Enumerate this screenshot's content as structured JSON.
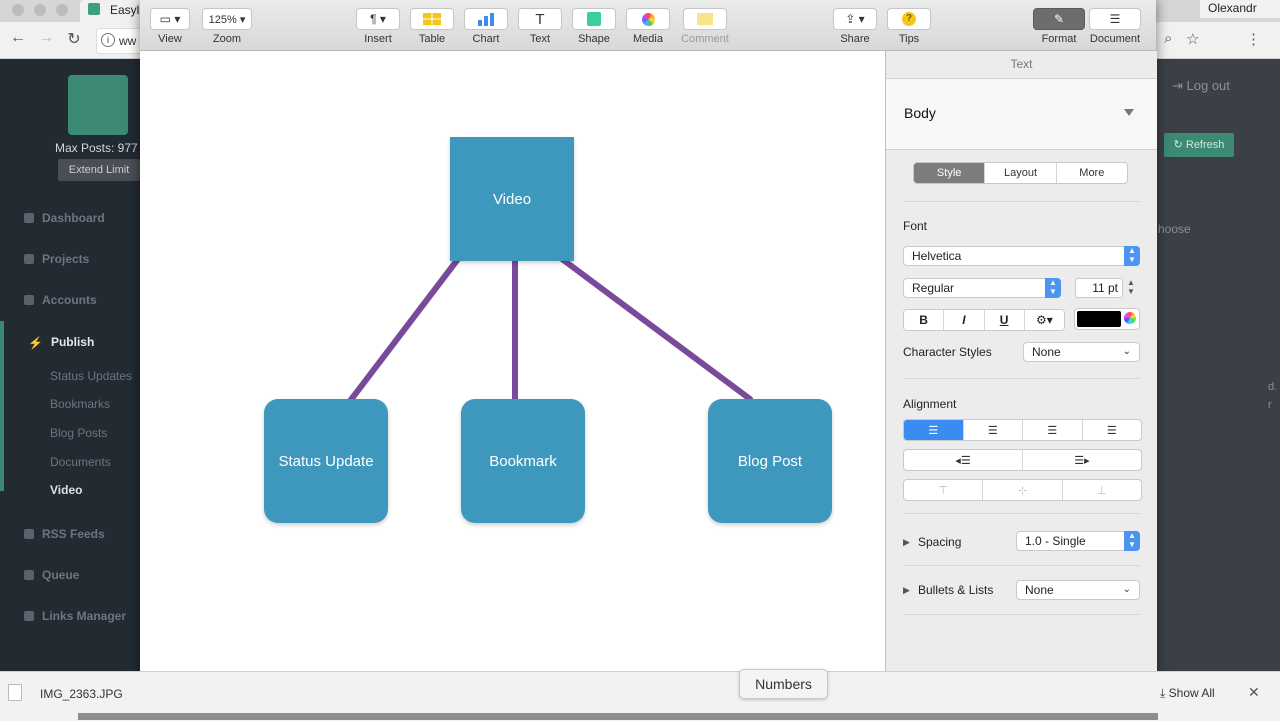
{
  "browser": {
    "tab_title": "Easyl",
    "profile_name": "Olexandr",
    "url_partial": "ww",
    "back": "←",
    "forward": "→",
    "reload": "↻",
    "zoom_glyph": "⌕",
    "star_glyph": "☆",
    "menu_glyph": "⋮"
  },
  "app_sidebar": {
    "max_posts": "Max Posts: 977",
    "extend_limit": "Extend Limit",
    "menu": {
      "dashboard": "Dashboard",
      "projects": "Projects",
      "accounts": "Accounts",
      "publish": "Publish",
      "publish_icon": "⚡",
      "rss_feeds": "RSS Feeds",
      "queue": "Queue",
      "links_manager": "Links Manager"
    },
    "publish_sub": {
      "status_updates": "Status Updates",
      "bookmarks": "Bookmarks",
      "blog_posts": "Blog Posts",
      "documents": "Documents",
      "video": "Video"
    }
  },
  "app_right": {
    "logout": "Log out",
    "refresh": "Refresh",
    "hint": "hoose",
    "frag1": "d.",
    "frag2": "r"
  },
  "toolbar": {
    "view": "View",
    "view_glyph": "▭ ▾",
    "zoom": "Zoom",
    "zoom_value": "125% ▾",
    "insert": "Insert",
    "insert_glyph": "¶ ▾",
    "table": "Table",
    "chart": "Chart",
    "text": "Text",
    "text_glyph": "T",
    "shape": "Shape",
    "media": "Media",
    "comment": "Comment",
    "share": "Share",
    "share_glyph": "⇪ ▾",
    "tips": "Tips",
    "tips_glyph": "?",
    "format": "Format",
    "format_glyph": "✎",
    "document": "Document",
    "document_glyph": "☰"
  },
  "diagram": {
    "top": "Video",
    "left": "Status Update",
    "middle": "Bookmark",
    "right": "Blog Post",
    "node_color": "#3e98bd",
    "connector_color": "#7a4a9a"
  },
  "inspector": {
    "title": "Text",
    "paragraph_style": "Body",
    "tabs": [
      "Style",
      "Layout",
      "More"
    ],
    "font_label": "Font",
    "font_family": "Helvetica",
    "font_typeface": "Regular",
    "font_size": "11 pt",
    "bold": "B",
    "italic": "I",
    "underline": "U",
    "gear": "⚙▾",
    "char_styles_label": "Character Styles",
    "char_styles_value": "None",
    "alignment_label": "Alignment",
    "spacing_label": "Spacing",
    "spacing_value": "1.0 - Single",
    "bullets_label": "Bullets & Lists",
    "bullets_value": "None",
    "text_color": "#000000"
  },
  "downloads": {
    "file": "IMG_2363.JPG",
    "show_all": "Show All",
    "close": "✕"
  },
  "tooltip": {
    "numbers": "Numbers"
  }
}
